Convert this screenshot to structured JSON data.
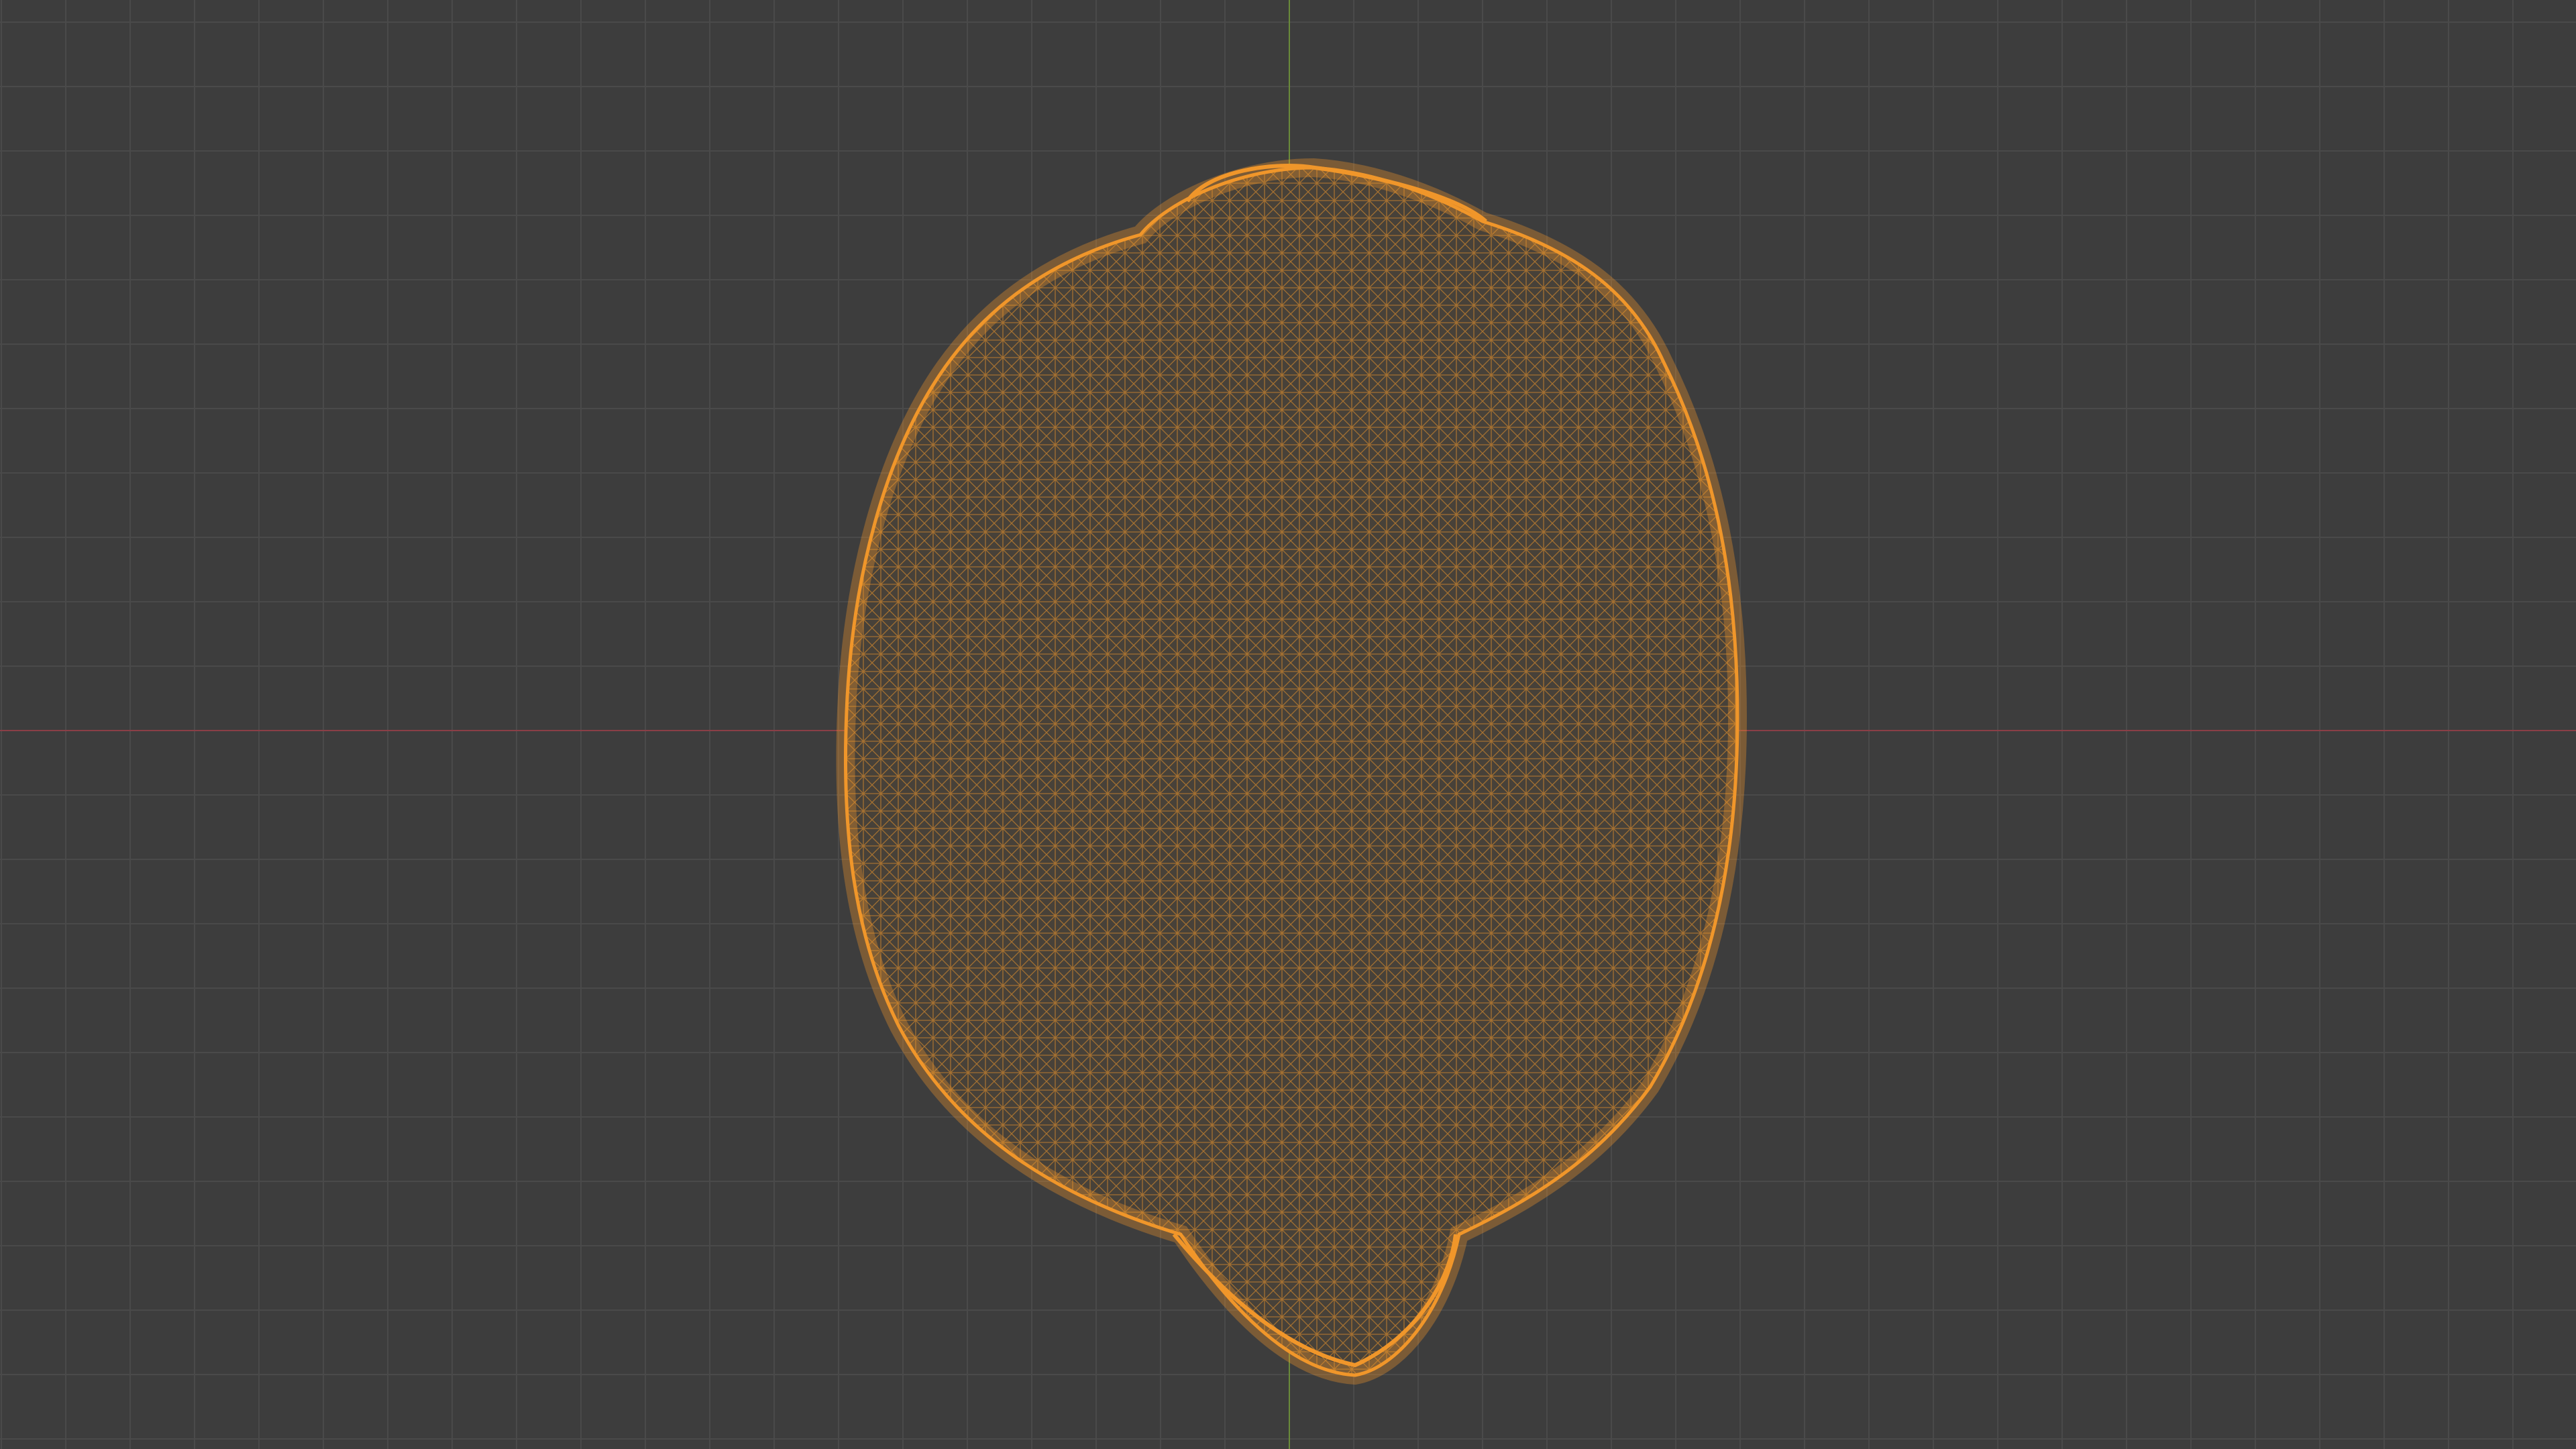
{
  "viewport": {
    "view": "wireframe",
    "background_color": "#3d3d3d",
    "grid": true,
    "grid_color": "#4a4a4a",
    "x_axis_color": "#8a3f47",
    "y_axis_color": "#6a8a3a",
    "object": {
      "shape": "lemon",
      "wire_color": "#f0962a",
      "selected": true
    }
  }
}
